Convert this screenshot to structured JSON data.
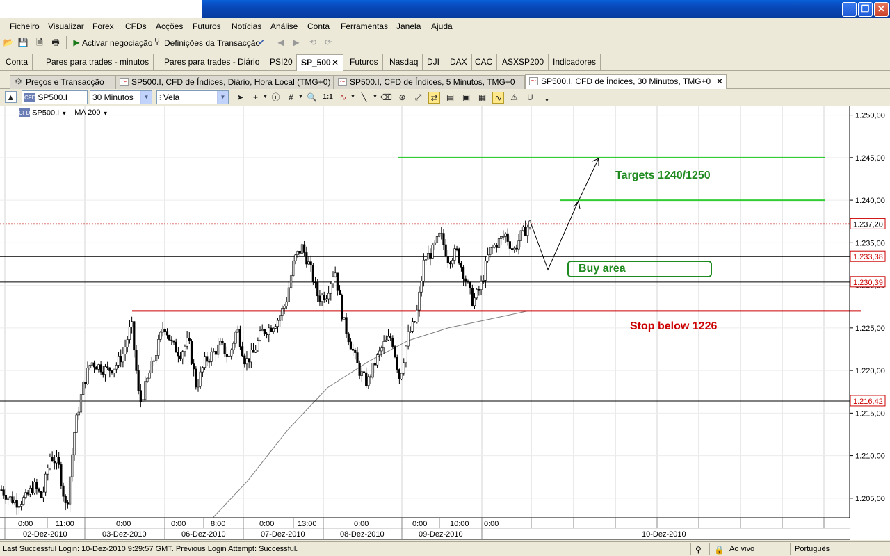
{
  "menu": [
    "Ficheiro",
    "Visualizar",
    "Forex",
    "CFDs",
    "Acções",
    "Futuros",
    "Notícias",
    "Análise",
    "Conta",
    "Ferramentas",
    "Janela",
    "Ajuda"
  ],
  "toolbar": {
    "activate_label": "Activar negociação",
    "settings_label": "Definições da Transacção"
  },
  "workspace_tabs": [
    "Conta",
    "Pares para trades - minutos",
    "Pares para trades - Diário",
    "PSI20",
    "SP_500",
    "Futuros",
    "Nasdaq",
    "DJI",
    "DAX",
    "CAC",
    "ASXSP200",
    "Indicadores"
  ],
  "active_workspace_tab": "SP_500",
  "window_tabs": [
    "Preços e Transacção",
    "SP500.I, CFD de Índices, Diário, Hora Local (TMG+0)",
    "SP500.I, CFD de Índices, 5 Minutos, TMG+0",
    "SP500.I, CFD de Índices, 30 Minutos, TMG+0"
  ],
  "chart_toolbar": {
    "symbol": "SP500.I",
    "timeframe": "30 Minutos",
    "chart_style": "Vela"
  },
  "legend": {
    "symbol": "SP500.I",
    "indicator": "MA 200"
  },
  "annotations": {
    "targets": "Targets 1240/1250",
    "buy_area": "Buy area",
    "stop": "Stop below 1226"
  },
  "colors": {
    "target_lines": "#33cc33",
    "stop_line": "#cc0000",
    "current_price_line": "#cc0000",
    "ma_line": "#808080",
    "candle_up": "#ffffff",
    "candle_down": "#000000"
  },
  "chart_data": {
    "type": "candlestick",
    "symbol": "SP500.I",
    "timeframe": "30 Minutos",
    "ylim": [
      1203,
      1251.5
    ],
    "y_ticks": [
      "1.250,00",
      "1.245,00",
      "1.240,00",
      "1.235,00",
      "1.230,00",
      "1.225,00",
      "1.220,00",
      "1.215,00",
      "1.210,00",
      "1.205,00"
    ],
    "price_labels": [
      {
        "label": "1.237,20",
        "value": 1237.2,
        "kind": "current"
      },
      {
        "label": "1.233,38",
        "value": 1233.38,
        "kind": "level"
      },
      {
        "label": "1.230,39",
        "value": 1230.39,
        "kind": "level"
      },
      {
        "label": "1.216,42",
        "value": 1216.42,
        "kind": "level"
      }
    ],
    "horizontal_lines": [
      {
        "name": "target-1250",
        "value": 1245.0,
        "color": "green"
      },
      {
        "name": "target-1240",
        "value": 1240.0,
        "color": "green"
      },
      {
        "name": "stop-1226",
        "value": 1227.0,
        "color": "red"
      },
      {
        "name": "resistance",
        "value": 1233.38,
        "color": "black"
      },
      {
        "name": "support-upper",
        "value": 1230.39,
        "color": "black"
      },
      {
        "name": "support-lower",
        "value": 1216.42,
        "color": "black"
      }
    ],
    "time_labels_top": [
      "0:00",
      "11:00",
      "0:00",
      "0:00",
      "8:00",
      "0:00",
      "13:00",
      "0:00",
      "0:00",
      "10:00",
      "0:00"
    ],
    "date_labels": [
      "02-Dez-2010",
      "03-Dez-2010",
      "06-Dez-2010",
      "07-Dez-2010",
      "08-Dez-2010",
      "09-Dez-2010",
      "10-Dez-2010"
    ],
    "close_path": [
      1206,
      1205,
      1204.5,
      1205,
      1206.5,
      1205,
      1210,
      1209,
      1203.5,
      1213,
      1218,
      1221,
      1220.5,
      1220,
      1220.5,
      1222,
      1225.5,
      1216,
      1219,
      1222,
      1225.5,
      1223,
      1222,
      1223.5,
      1218,
      1221,
      1222,
      1223,
      1221.5,
      1225,
      1221,
      1222,
      1224.5,
      1225,
      1226,
      1228,
      1233,
      1234.5,
      1232,
      1228.5,
      1229,
      1232,
      1226,
      1223,
      1220,
      1218.5,
      1221,
      1223,
      1224,
      1219,
      1224,
      1226,
      1233,
      1234,
      1236,
      1233,
      1234,
      1231,
      1228,
      1230,
      1234,
      1235,
      1236,
      1234,
      1236,
      1237.2
    ],
    "ma200_path": [
      1202,
      1207,
      1213,
      1218,
      1221,
      1223.5,
      1225,
      1226,
      1227
    ]
  },
  "status": {
    "login_text": "Last Successful Login: 10-Dez-2010 9:29:57 GMT. Previous Login Attempt: Successful.",
    "live_label": "Ao vivo",
    "language": "Português"
  }
}
